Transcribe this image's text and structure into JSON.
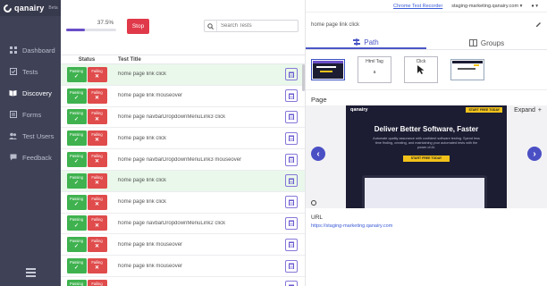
{
  "brand": {
    "name": "qanairy",
    "tag": "Beta"
  },
  "sidebar": {
    "items": [
      {
        "label": "Dashboard",
        "icon": "grid-icon"
      },
      {
        "label": "Tests",
        "icon": "checklist-icon"
      },
      {
        "label": "Discovery",
        "icon": "book-icon",
        "active": true
      },
      {
        "label": "Forms",
        "icon": "forms-icon"
      },
      {
        "label": "Test Users",
        "icon": "users-icon"
      },
      {
        "label": "Feedback",
        "icon": "chat-icon"
      }
    ]
  },
  "progress": {
    "label": "37.5%",
    "fraction": 0.375
  },
  "stop_label": "Stop",
  "search": {
    "placeholder": "Search Tests"
  },
  "table": {
    "headers": {
      "status": "Status",
      "title": "Test Title"
    },
    "passing_label": "Passing",
    "failing_label": "Failing",
    "rows": [
      {
        "title": "home page link click",
        "highlight": true
      },
      {
        "title": "home page link mouseover",
        "highlight": false
      },
      {
        "title": "home page navbarDropdownMenuLink3 click",
        "highlight": false
      },
      {
        "title": "home page link click",
        "highlight": false
      },
      {
        "title": "home page navbarDropdownMenuLink3 mouseover",
        "highlight": false
      },
      {
        "title": "home page link click",
        "highlight": true
      },
      {
        "title": "home page link click",
        "highlight": false
      },
      {
        "title": "home page navbarDropdownMenuLink2 click",
        "highlight": false
      },
      {
        "title": "home page link mouseover",
        "highlight": false
      },
      {
        "title": "home page link mouseover",
        "highlight": false
      },
      {
        "title": "",
        "highlight": false
      }
    ]
  },
  "topbar": {
    "recorder": "Chrome Test Recorder",
    "domain": "staging-marketing.qanairy.com"
  },
  "detail": {
    "step_title": "home page link click",
    "tabs": {
      "path": "Path",
      "groups": "Groups"
    },
    "steps": {
      "html_tag": "Html Tag",
      "html_tag_value": "a",
      "click": "Click"
    },
    "page_label": "Page",
    "expand": "Expand",
    "preview": {
      "brand": "qanairy",
      "nav_cta": "START FREE TODAY",
      "headline": "Deliver Better Software, Faster",
      "body": "Automate quality assurance with confident software testing. Spend less time finding, creating, and maintaining your automated tests with the power of AI.",
      "cta": "START FREE TODAY"
    },
    "url_label": "URL",
    "url_value": "https://staging-marketing.qanairy.com"
  },
  "colors": {
    "sidebar": "#3f4257",
    "accent": "#4b4fc4",
    "stop": "#e03a4a",
    "passing": "#3fb24f",
    "failing": "#e04b4b"
  }
}
